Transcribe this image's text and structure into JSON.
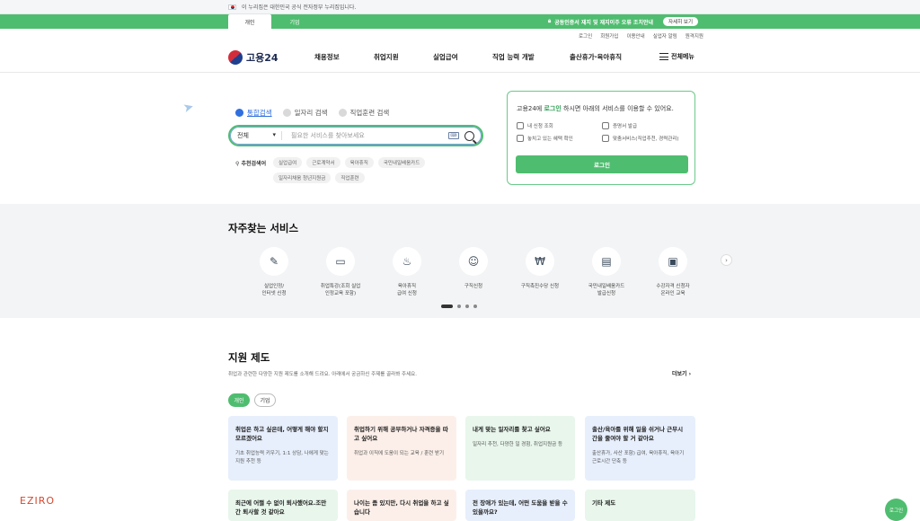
{
  "gov_bar": {
    "text": "이 누리집은 대한민국 공식 전자정부 누리집입니다."
  },
  "top_tabs": {
    "personal": "개인",
    "corporate": "기업"
  },
  "notice": {
    "text": "공동인증서 재지 및 재지이주 오류 조치안내",
    "button": "자세히 보기"
  },
  "utility_links": [
    "로그인",
    "회원가입",
    "이용안내",
    "실업자 알림",
    "원격지원"
  ],
  "logo": {
    "text": "고용24"
  },
  "gnb": [
    "채용정보",
    "취업지원",
    "실업급여",
    "직업 능력 개발",
    "출산휴가·육아휴직"
  ],
  "gnb_all_menu": "전체메뉴",
  "search": {
    "radios": [
      {
        "label": "통합검색",
        "checked": true
      },
      {
        "label": "일자리 검색",
        "checked": false
      },
      {
        "label": "직업훈련 검색",
        "checked": false
      }
    ],
    "scope": "전체",
    "placeholder": "필요한 서비스를 찾아보세요",
    "recommend_label": "추천검색어",
    "chips": [
      "실업급여",
      "근로계약서",
      "육아휴직",
      "국민내일배움카드",
      "일자리채움 청년지원금",
      "직업훈련"
    ]
  },
  "login_card": {
    "title_prefix": "고용24에 ",
    "title_link": "로그인",
    "title_suffix": " 하시면 아래의 서비스를 이용할 수 있어요.",
    "items": [
      "내 신청 조회",
      "증명서 발급",
      "놓치고 있는 혜택 확인",
      "맞춤서비스(직업추천, 경력관리)"
    ],
    "button": "로그인"
  },
  "services": {
    "title": "자주찾는 서비스",
    "items": [
      {
        "label": "실업인정/\n인터넷 신청",
        "icon": "document-pen-icon",
        "glyph": "✎"
      },
      {
        "label": "취업특강(조회 실업\n인정교육 포함)",
        "icon": "presentation-board-icon",
        "glyph": "▭"
      },
      {
        "label": "육아휴직\n급여 신청",
        "icon": "baby-bottle-icon",
        "glyph": "♨"
      },
      {
        "label": "구직신청",
        "icon": "person-check-icon",
        "glyph": "☺"
      },
      {
        "label": "구직촉진수당 신청",
        "icon": "money-bag-icon",
        "glyph": "₩"
      },
      {
        "label": "국민내일배움카드\n발급신청",
        "icon": "credit-card-icon",
        "glyph": "▤"
      },
      {
        "label": "수강자격 신청자\n온라인 교육",
        "icon": "monitor-check-icon",
        "glyph": "▣"
      }
    ],
    "pages": 4,
    "active_page": 1
  },
  "support": {
    "title": "지원 제도",
    "desc": "취업과 관련한 다양한 지원 제도를 소개해 드려요. 아래에서 궁금하신 주제를 골라봐 주세요.",
    "more": "더보기",
    "tabs": [
      "개인",
      "기업"
    ],
    "cards": [
      {
        "title": "취업은 하고 싶은데, 어떻게 해야 할지 모르겠어요",
        "body": "기초 취업능력 키우기, 1:1 상담, 나에게 맞는 지원 추천 등",
        "color": "blue"
      },
      {
        "title": "취업하기 위해 공부하거나 자격증을 따고 싶어요",
        "body": "취업과 이직에 도움이 되는 교육 / 훈련 받기",
        "color": "pink"
      },
      {
        "title": "내게 맞는 일자리를 찾고 싶어요",
        "body": "일자리 추천, 다양한 일 경험, 취업지원금 등",
        "color": "green"
      },
      {
        "title": "출산/육아를 위해 일을 쉬거나 근무시간을 줄여야 할 거 같아요",
        "body": "출산휴가, 사산 포함) 급여, 육아휴직, 육아기 근로시간 단축 등",
        "color": "blue"
      },
      {
        "title": "최근에 어쩔 수 없이 퇴사했어요.조만간 퇴사할 것 같아요",
        "body": "",
        "color": "green"
      },
      {
        "title": "나이는 좀 있지만, 다시 취업을 하고 싶습니다",
        "body": "",
        "color": "pink"
      },
      {
        "title": "전 장애가 있는데, 어떤 도움을 받을 수 있을까요?",
        "body": "",
        "color": "blue"
      },
      {
        "title": "기타 제도",
        "body": "",
        "color": "green"
      }
    ]
  },
  "watermark": "EZIRO",
  "fab": "로그인",
  "colors": {
    "primary_green": "#4fbd6f",
    "link_blue": "#2f6fe0"
  }
}
